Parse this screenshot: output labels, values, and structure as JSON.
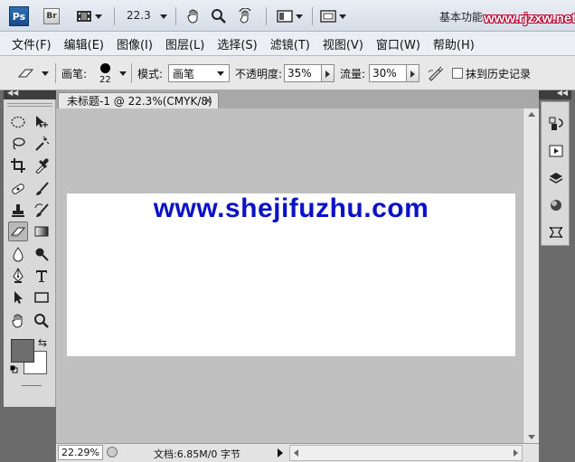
{
  "appbar": {
    "logo": "Ps",
    "bridge": "Br",
    "zoom": "22.3",
    "workspace": "基本功能",
    "watermark": "www.rjzxw.net"
  },
  "menu": [
    {
      "label": "文件(F)"
    },
    {
      "label": "编辑(E)"
    },
    {
      "label": "图像(I)"
    },
    {
      "label": "图层(L)"
    },
    {
      "label": "选择(S)"
    },
    {
      "label": "滤镜(T)"
    },
    {
      "label": "视图(V)"
    },
    {
      "label": "窗口(W)"
    },
    {
      "label": "帮助(H)"
    }
  ],
  "options": {
    "brush_label": "画笔:",
    "brush_size": "22",
    "mode_label": "模式:",
    "mode_value": "画笔",
    "opacity_label": "不透明度:",
    "opacity_value": "35%",
    "flow_label": "流量:",
    "flow_value": "30%",
    "history_label": "抹到历史记录"
  },
  "document": {
    "tab_title": "未标题-1 @ 22.3%(CMYK/8)",
    "close": "×",
    "canvas_text": "www.shejifuzhu.com"
  },
  "status": {
    "zoom": "22.29%",
    "doc_info": "文档:6.85M/0 字节"
  },
  "colors": {
    "foreground": "#6e6e6e",
    "background": "#ffffff",
    "canvas_text": "#0a12c8"
  }
}
